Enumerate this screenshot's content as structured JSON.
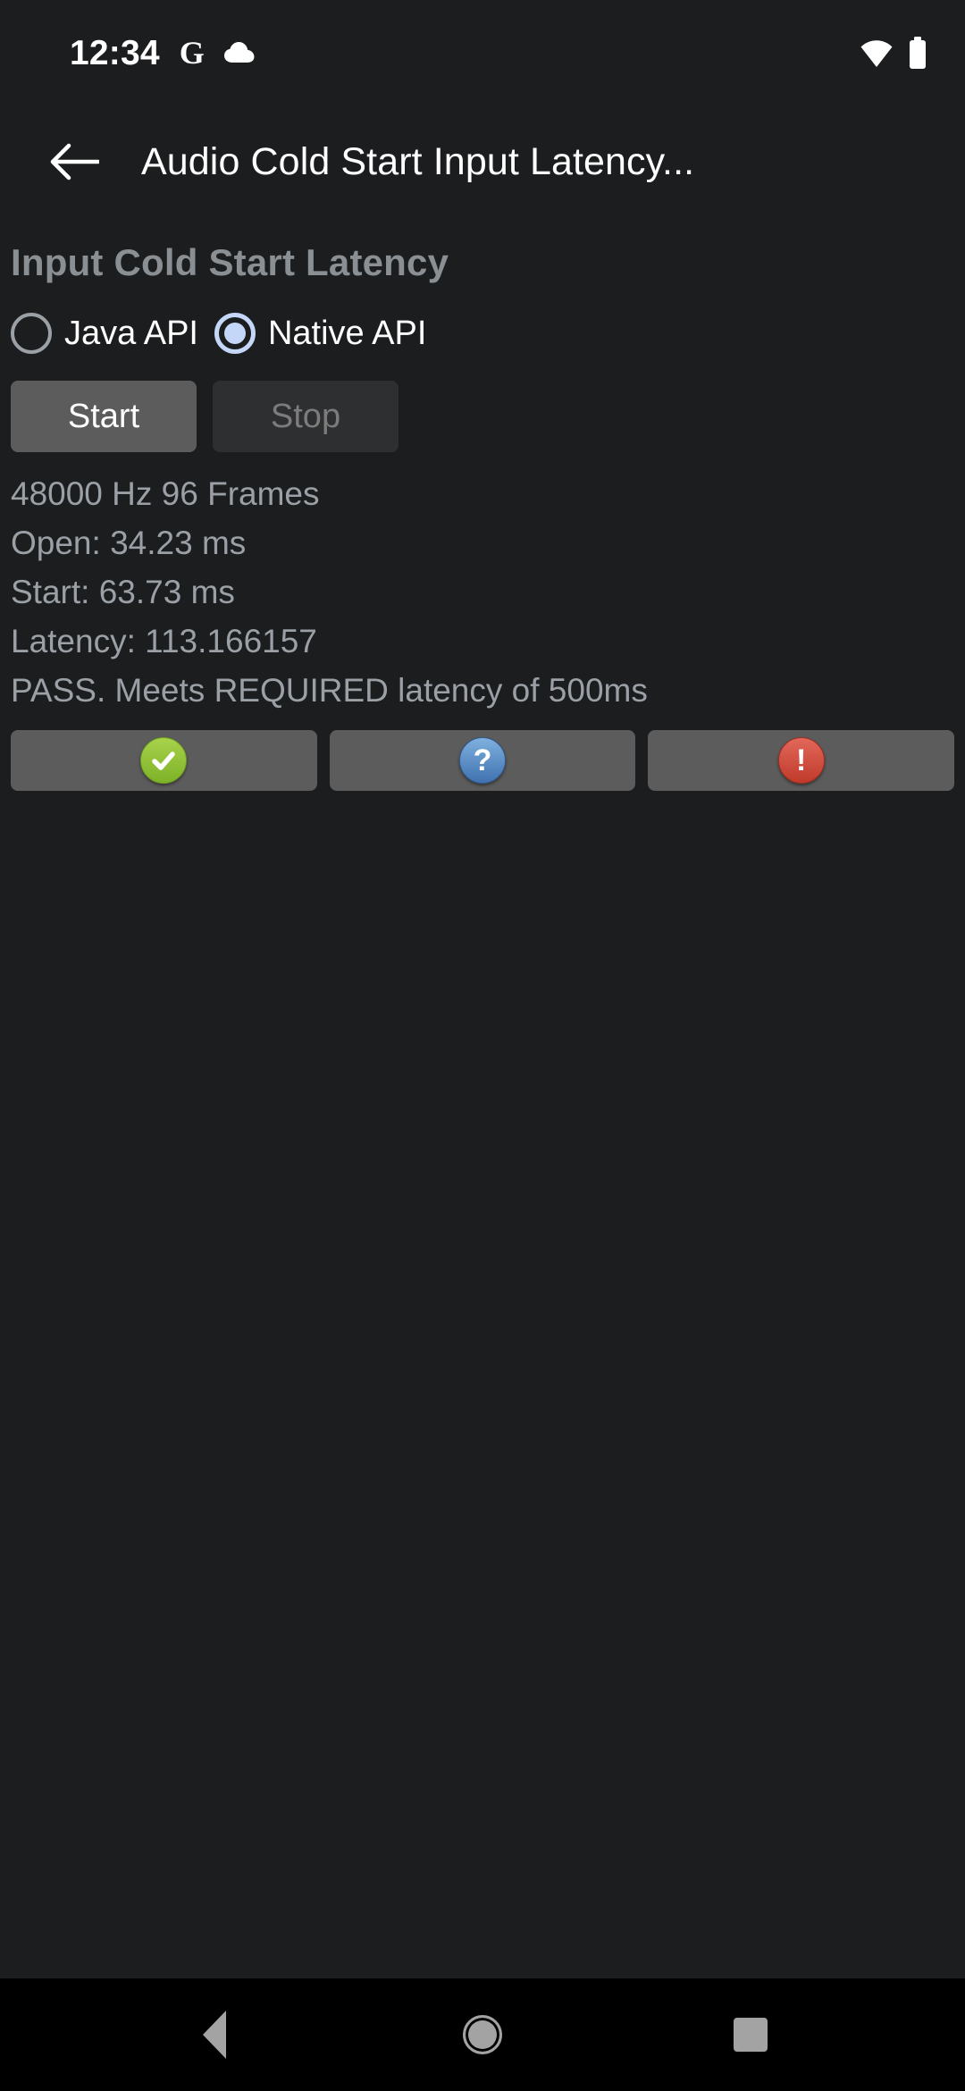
{
  "status_bar": {
    "clock": "12:34",
    "icons_left": [
      "google-g-icon",
      "cloud-icon"
    ],
    "icons_right": [
      "wifi-icon",
      "battery-icon"
    ],
    "g_glyph": "G"
  },
  "app_bar": {
    "back_icon": "back-arrow-icon",
    "title": "Audio Cold Start Input Latency..."
  },
  "main": {
    "section_heading": "Input Cold Start Latency",
    "radio_group": {
      "options": [
        {
          "label": "Java API",
          "selected": false
        },
        {
          "label": "Native API",
          "selected": true
        }
      ],
      "selected_color": "#C5D7F8"
    },
    "controls": {
      "start_label": "Start",
      "stop_label": "Stop",
      "start_enabled": true,
      "stop_enabled": false
    },
    "results": [
      "48000 Hz 96 Frames",
      "Open: 34.23 ms",
      "Start: 63.73 ms",
      "Latency: 113.166157",
      "PASS. Meets REQUIRED latency of 500ms"
    ],
    "verdict_buttons": [
      {
        "name": "pass-button",
        "icon": "check-circle-icon",
        "glyph": "✓",
        "color": "#8CC63F"
      },
      {
        "name": "unknown-button",
        "icon": "question-circle-icon",
        "glyph": "?",
        "color": "#4A7AB8"
      },
      {
        "name": "fail-button",
        "icon": "exclamation-circle-icon",
        "glyph": "!",
        "color": "#D9544A"
      }
    ]
  },
  "nav_bar": {
    "back": "nav-back-icon",
    "home": "nav-home-icon",
    "recents": "nav-recents-icon"
  }
}
